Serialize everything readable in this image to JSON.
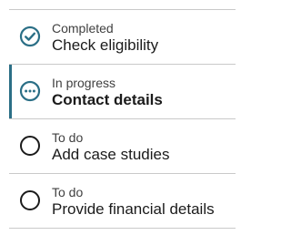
{
  "steps": [
    {
      "status": "Completed",
      "title": "Check eligibility",
      "icon": "check-circle-icon",
      "state": "completed"
    },
    {
      "status": "In progress",
      "title": "Contact details",
      "icon": "ellipsis-circle-icon",
      "state": "current"
    },
    {
      "status": "To do",
      "title": "Add case studies",
      "icon": "empty-circle-icon",
      "state": "todo"
    },
    {
      "status": "To do",
      "title": "Provide financial details",
      "icon": "empty-circle-icon",
      "state": "todo"
    }
  ],
  "colors": {
    "accent": "#2b6f86",
    "icon_dark": "#1b1b1b",
    "divider": "#c9c9c9"
  }
}
